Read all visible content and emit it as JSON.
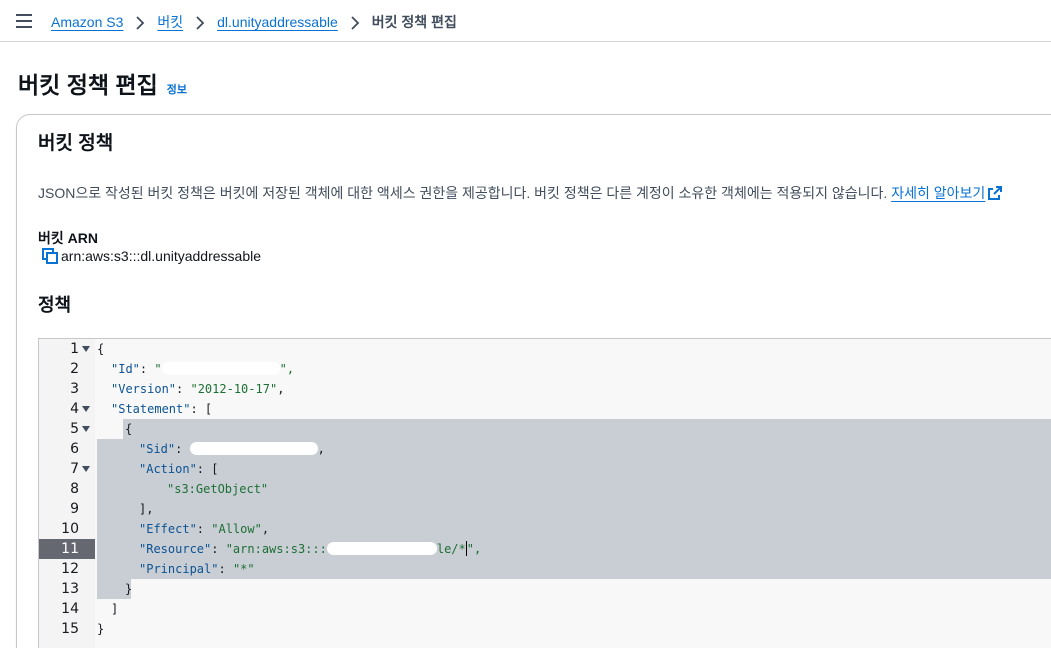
{
  "breadcrumb": {
    "items": [
      "Amazon S3",
      "버킷",
      "dl.unityaddressable"
    ],
    "current": "버킷 정책 편집"
  },
  "header": {
    "title": "버킷 정책 편집",
    "info": "정보"
  },
  "section": {
    "title": "버킷 정책",
    "description": "JSON으로 작성된 버킷 정책은 버킷에 저장된 객체에 대한 액세스 권한을 제공합니다. 버킷 정책은 다른 계정이 소유한 객체에는 적용되지 않습니다.",
    "learn_more": "자세히 알아보기",
    "arn_label": "버킷 ARN",
    "arn_value": "arn:aws:s3:::dl.unityaddressable",
    "policy_label": "정책"
  },
  "editor": {
    "line_numbers": [
      "1",
      "2",
      "3",
      "4",
      "5",
      "6",
      "7",
      "8",
      "9",
      "10",
      "11",
      "12",
      "13",
      "14",
      "15"
    ],
    "active_line": "11",
    "lines": {
      "l1": "{",
      "l2_key": "\"Id\"",
      "l2_val_start": "\"",
      "l2_val_end": "\",",
      "l3_key": "\"Version\"",
      "l3_val": "\"2012-10-17\"",
      "l4_key": "\"Statement\"",
      "l4_rest": ": [",
      "l5": "{",
      "l6_key": "\"Sid\"",
      "l6_rest": ",",
      "l7_key": "\"Action\"",
      "l7_rest": ": [",
      "l8_val": "\"s3:GetObject\"",
      "l9": "],",
      "l10_key": "\"Effect\"",
      "l10_val": "\"Allow\"",
      "l11_key": "\"Resource\"",
      "l11_val_start": "\"arn:aws:s3:::",
      "l11_val_end": "le/*",
      "l11_tail": "\",",
      "l12_key": "\"Principal\"",
      "l12_val": "\"*\"",
      "l13": "}",
      "l14": "]",
      "l15": "}"
    }
  },
  "colors": {
    "link": "#0972d3",
    "selection": "#c9cdd4",
    "active_gutter": "#656871",
    "json_key": "#0b5394",
    "json_string": "#1d7035"
  },
  "icons": {
    "menu": "hamburger-icon",
    "separator": "chevron-right-icon",
    "external": "external-link-icon",
    "copy": "copy-icon",
    "fold": "fold-caret-icon"
  }
}
